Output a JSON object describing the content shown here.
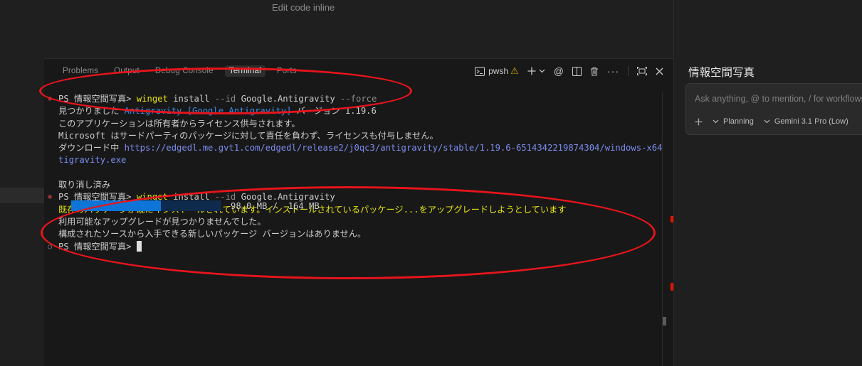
{
  "editor": {
    "hint": "Edit code inline"
  },
  "panel": {
    "tabs": [
      {
        "label": "Problems"
      },
      {
        "label": "Output"
      },
      {
        "label": "Debug Console"
      },
      {
        "label": "Terminal"
      },
      {
        "label": "Ports"
      }
    ],
    "toolbar": {
      "shell": "pwsh"
    }
  },
  "terminal": {
    "prompt1": "PS 情報空間写真> ",
    "cmd1_name": "winget",
    "cmd1_rest1": " install ",
    "cmd1_flag1": "--id",
    "cmd1_pkg": " Google.Antigravity ",
    "cmd1_flag2": "--force",
    "found_prefix": "見つかりました ",
    "found_name": "Antigravity [Google.Antigravity]",
    "found_version": " バージョン 1.19.6",
    "license1": "このアプリケーションは所有者からライセンス供与されます。",
    "license2": "Microsoft はサードパーティのパッケージに対して責任を負わず、ライセンスも付与しません。",
    "download_label": "ダウンロード中 ",
    "download_url1": "https://edgedl.me.gvt1.com/edgedl/release2/j0qc3/antigravity/stable/1.19.6-6514342219874304/windows-x64/An",
    "download_url2": "tigravity.exe",
    "progress": {
      "current_mb": 98.0,
      "total_mb": 164,
      "text": "98.0 MB /  164 MB"
    },
    "cancelled": "取り消し済み",
    "prompt2": "PS 情報空間写真> ",
    "cmd2_name": "winget",
    "cmd2_rest": " install ",
    "cmd2_flag": "--id",
    "cmd2_pkg": " Google.Antigravity",
    "existing": "既存のパッケージが既にインストールされています。インストールされているパッケージ...をアップグレードしようとしています",
    "no_upgrade": "利用可能なアップグレードが見つかりませんでした。",
    "no_version": "構成されたソースから入手できる新しいパッケージ バージョンはありません。",
    "prompt3": "PS 情報空間写真> "
  },
  "chat": {
    "title": "情報空間写真",
    "placeholder": "Ask anything, @ to mention, / for workflows",
    "mode": "Planning",
    "model": "Gemini 3.1 Pro (Low)"
  },
  "colors": {
    "accent": "#0e75d8",
    "annotation": "#e8141c",
    "command": "#e5e510",
    "link": "#3b8eea"
  }
}
